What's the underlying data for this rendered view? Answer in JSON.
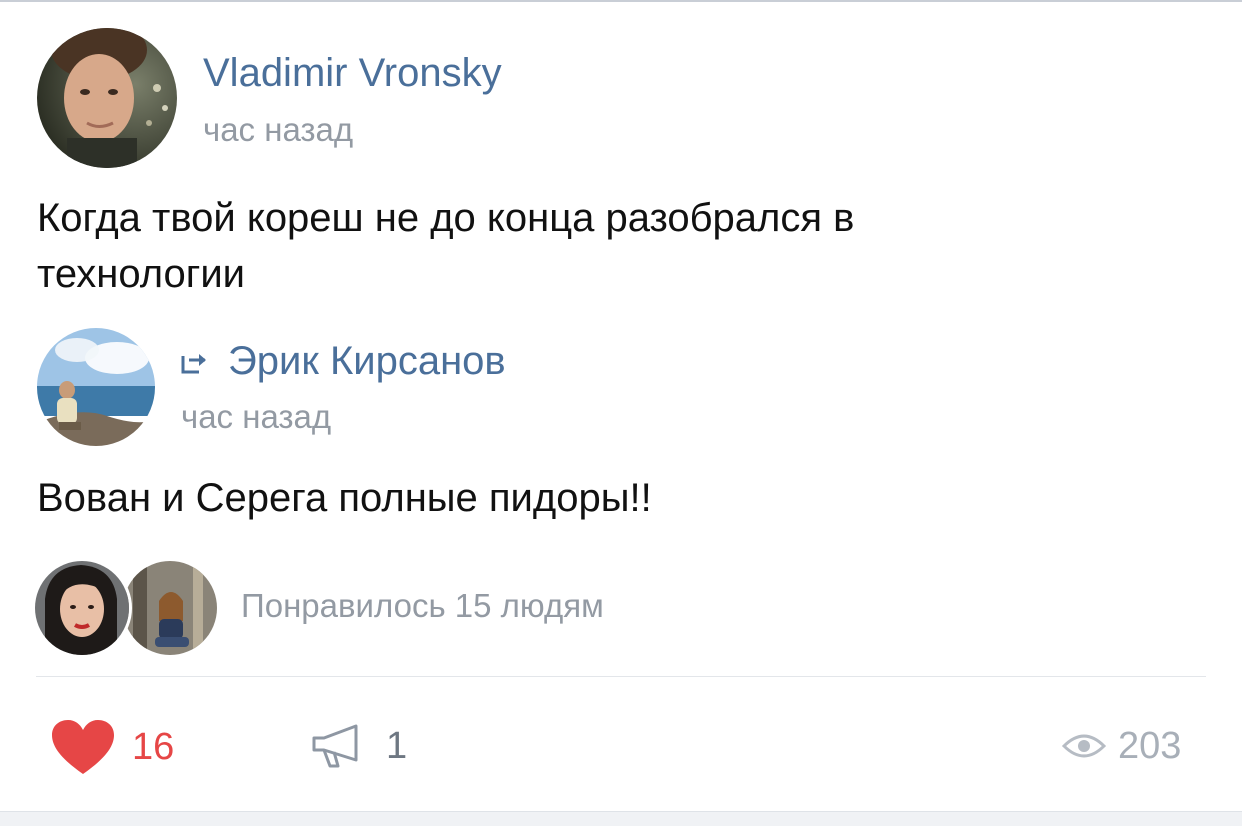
{
  "post": {
    "author": {
      "name": "Vladimir Vronsky",
      "time": "час назад"
    },
    "text": "Когда твой кореш не до конца разобрался в технологии",
    "repost": {
      "author": {
        "name": "Эрик Кирсанов",
        "time": "час назад"
      },
      "text": "Вован и Серега полные пидоры!!"
    },
    "likes_summary": "Понравилось 15 людям"
  },
  "actions": {
    "likes": "16",
    "shares": "1",
    "views": "203"
  },
  "icons": {
    "like": "heart-icon",
    "share": "megaphone-icon",
    "views": "eye-icon",
    "repost": "repost-arrow-icon"
  },
  "colors": {
    "link": "#4a6f9a",
    "muted": "#939aa3",
    "like_active": "#e64646",
    "text": "#111111"
  }
}
